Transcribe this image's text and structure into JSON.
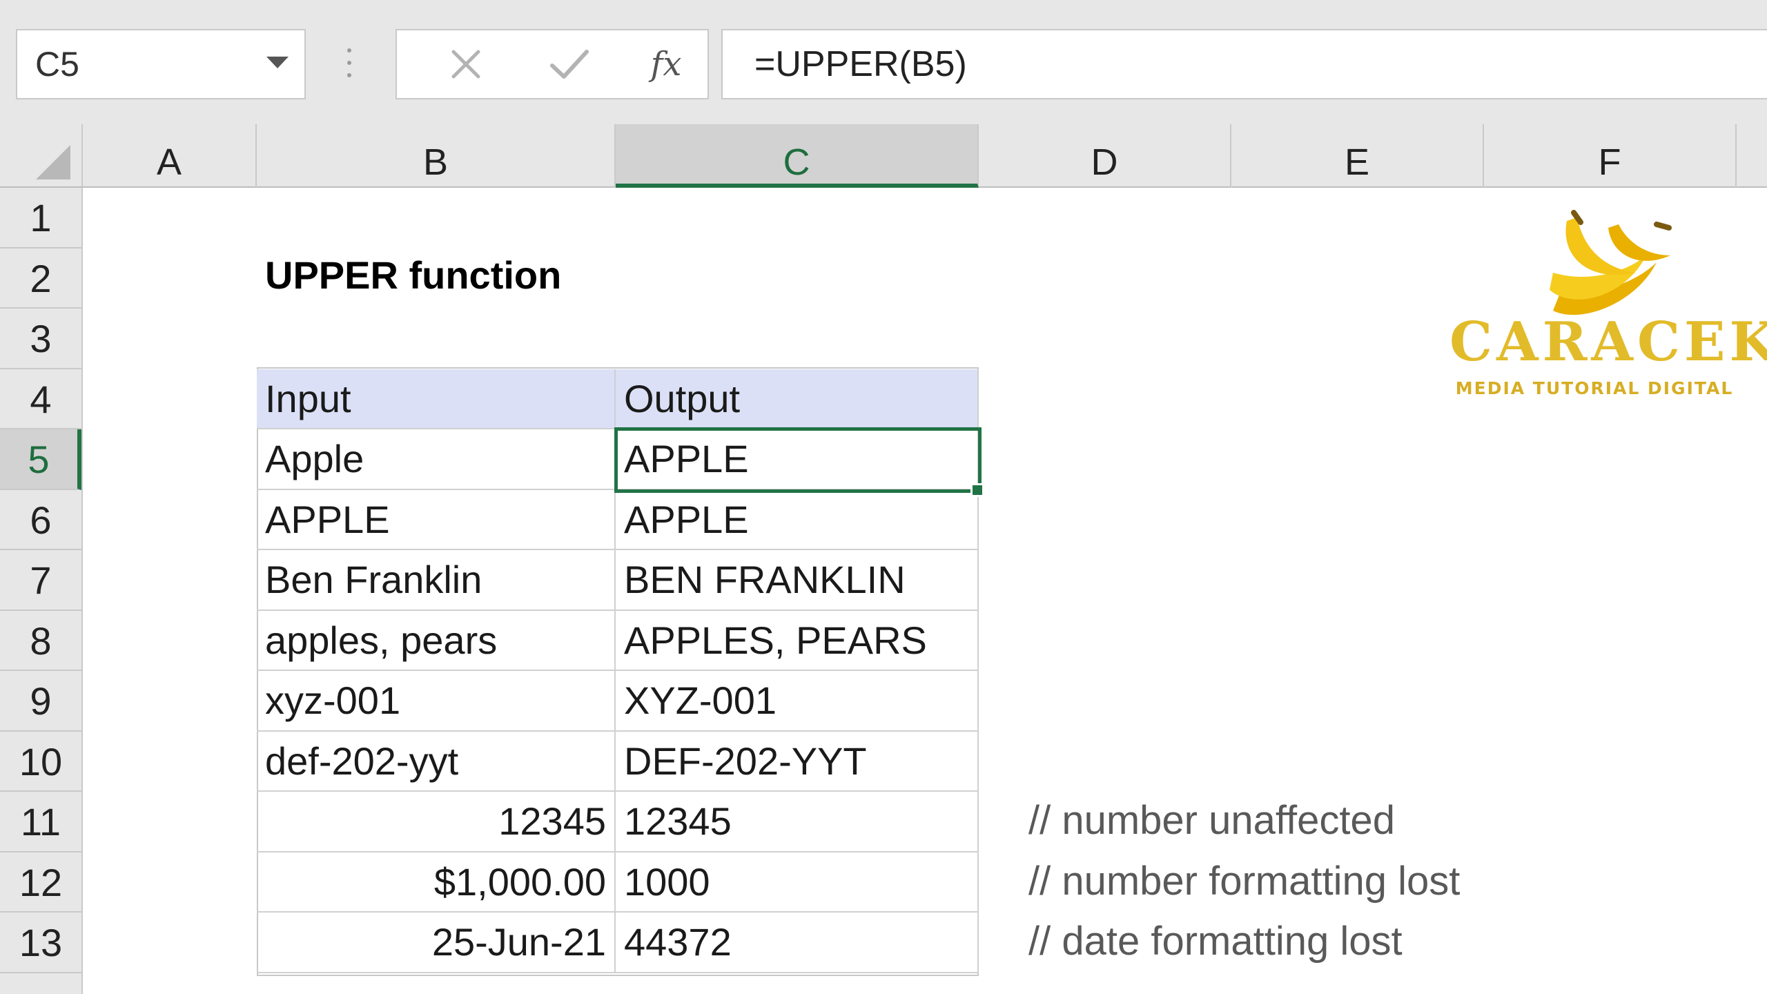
{
  "formula_bar": {
    "name_box": "C5",
    "insert_function_label": "fx",
    "formula": "=UPPER(B5)"
  },
  "columns": [
    "A",
    "B",
    "C",
    "D",
    "E",
    "F"
  ],
  "selected_column": "C",
  "rows": [
    "1",
    "2",
    "3",
    "4",
    "5",
    "6",
    "7",
    "8",
    "9",
    "10",
    "11",
    "12",
    "13"
  ],
  "selected_row": "5",
  "sheet": {
    "title": "UPPER function",
    "headers": {
      "input": "Input",
      "output": "Output"
    },
    "table": [
      {
        "input": "Apple",
        "output": "APPLE",
        "note": ""
      },
      {
        "input": "APPLE",
        "output": "APPLE",
        "note": ""
      },
      {
        "input": "Ben Franklin",
        "output": "BEN FRANKLIN",
        "note": ""
      },
      {
        "input": "apples, pears",
        "output": "APPLES, PEARS",
        "note": ""
      },
      {
        "input": "xyz-001",
        "output": "XYZ-001",
        "note": ""
      },
      {
        "input": "def-202-yyt",
        "output": "DEF-202-YYT",
        "note": ""
      },
      {
        "input": "12345",
        "output": "12345",
        "note": "// number unaffected",
        "numeric": true
      },
      {
        "input": "$1,000.00",
        "output": "1000",
        "note": "// number formatting lost",
        "numeric": true
      },
      {
        "input": "25-Jun-21",
        "output": "44372",
        "note": "// date formatting lost",
        "numeric": true
      }
    ]
  },
  "logo": {
    "name": "CARACEK",
    "tagline": "MEDIA TUTORIAL DIGITAL"
  },
  "colors": {
    "accent_green": "#217346",
    "header_fill": "#dbe0f6",
    "logo_yellow": "#e2bb2a"
  }
}
